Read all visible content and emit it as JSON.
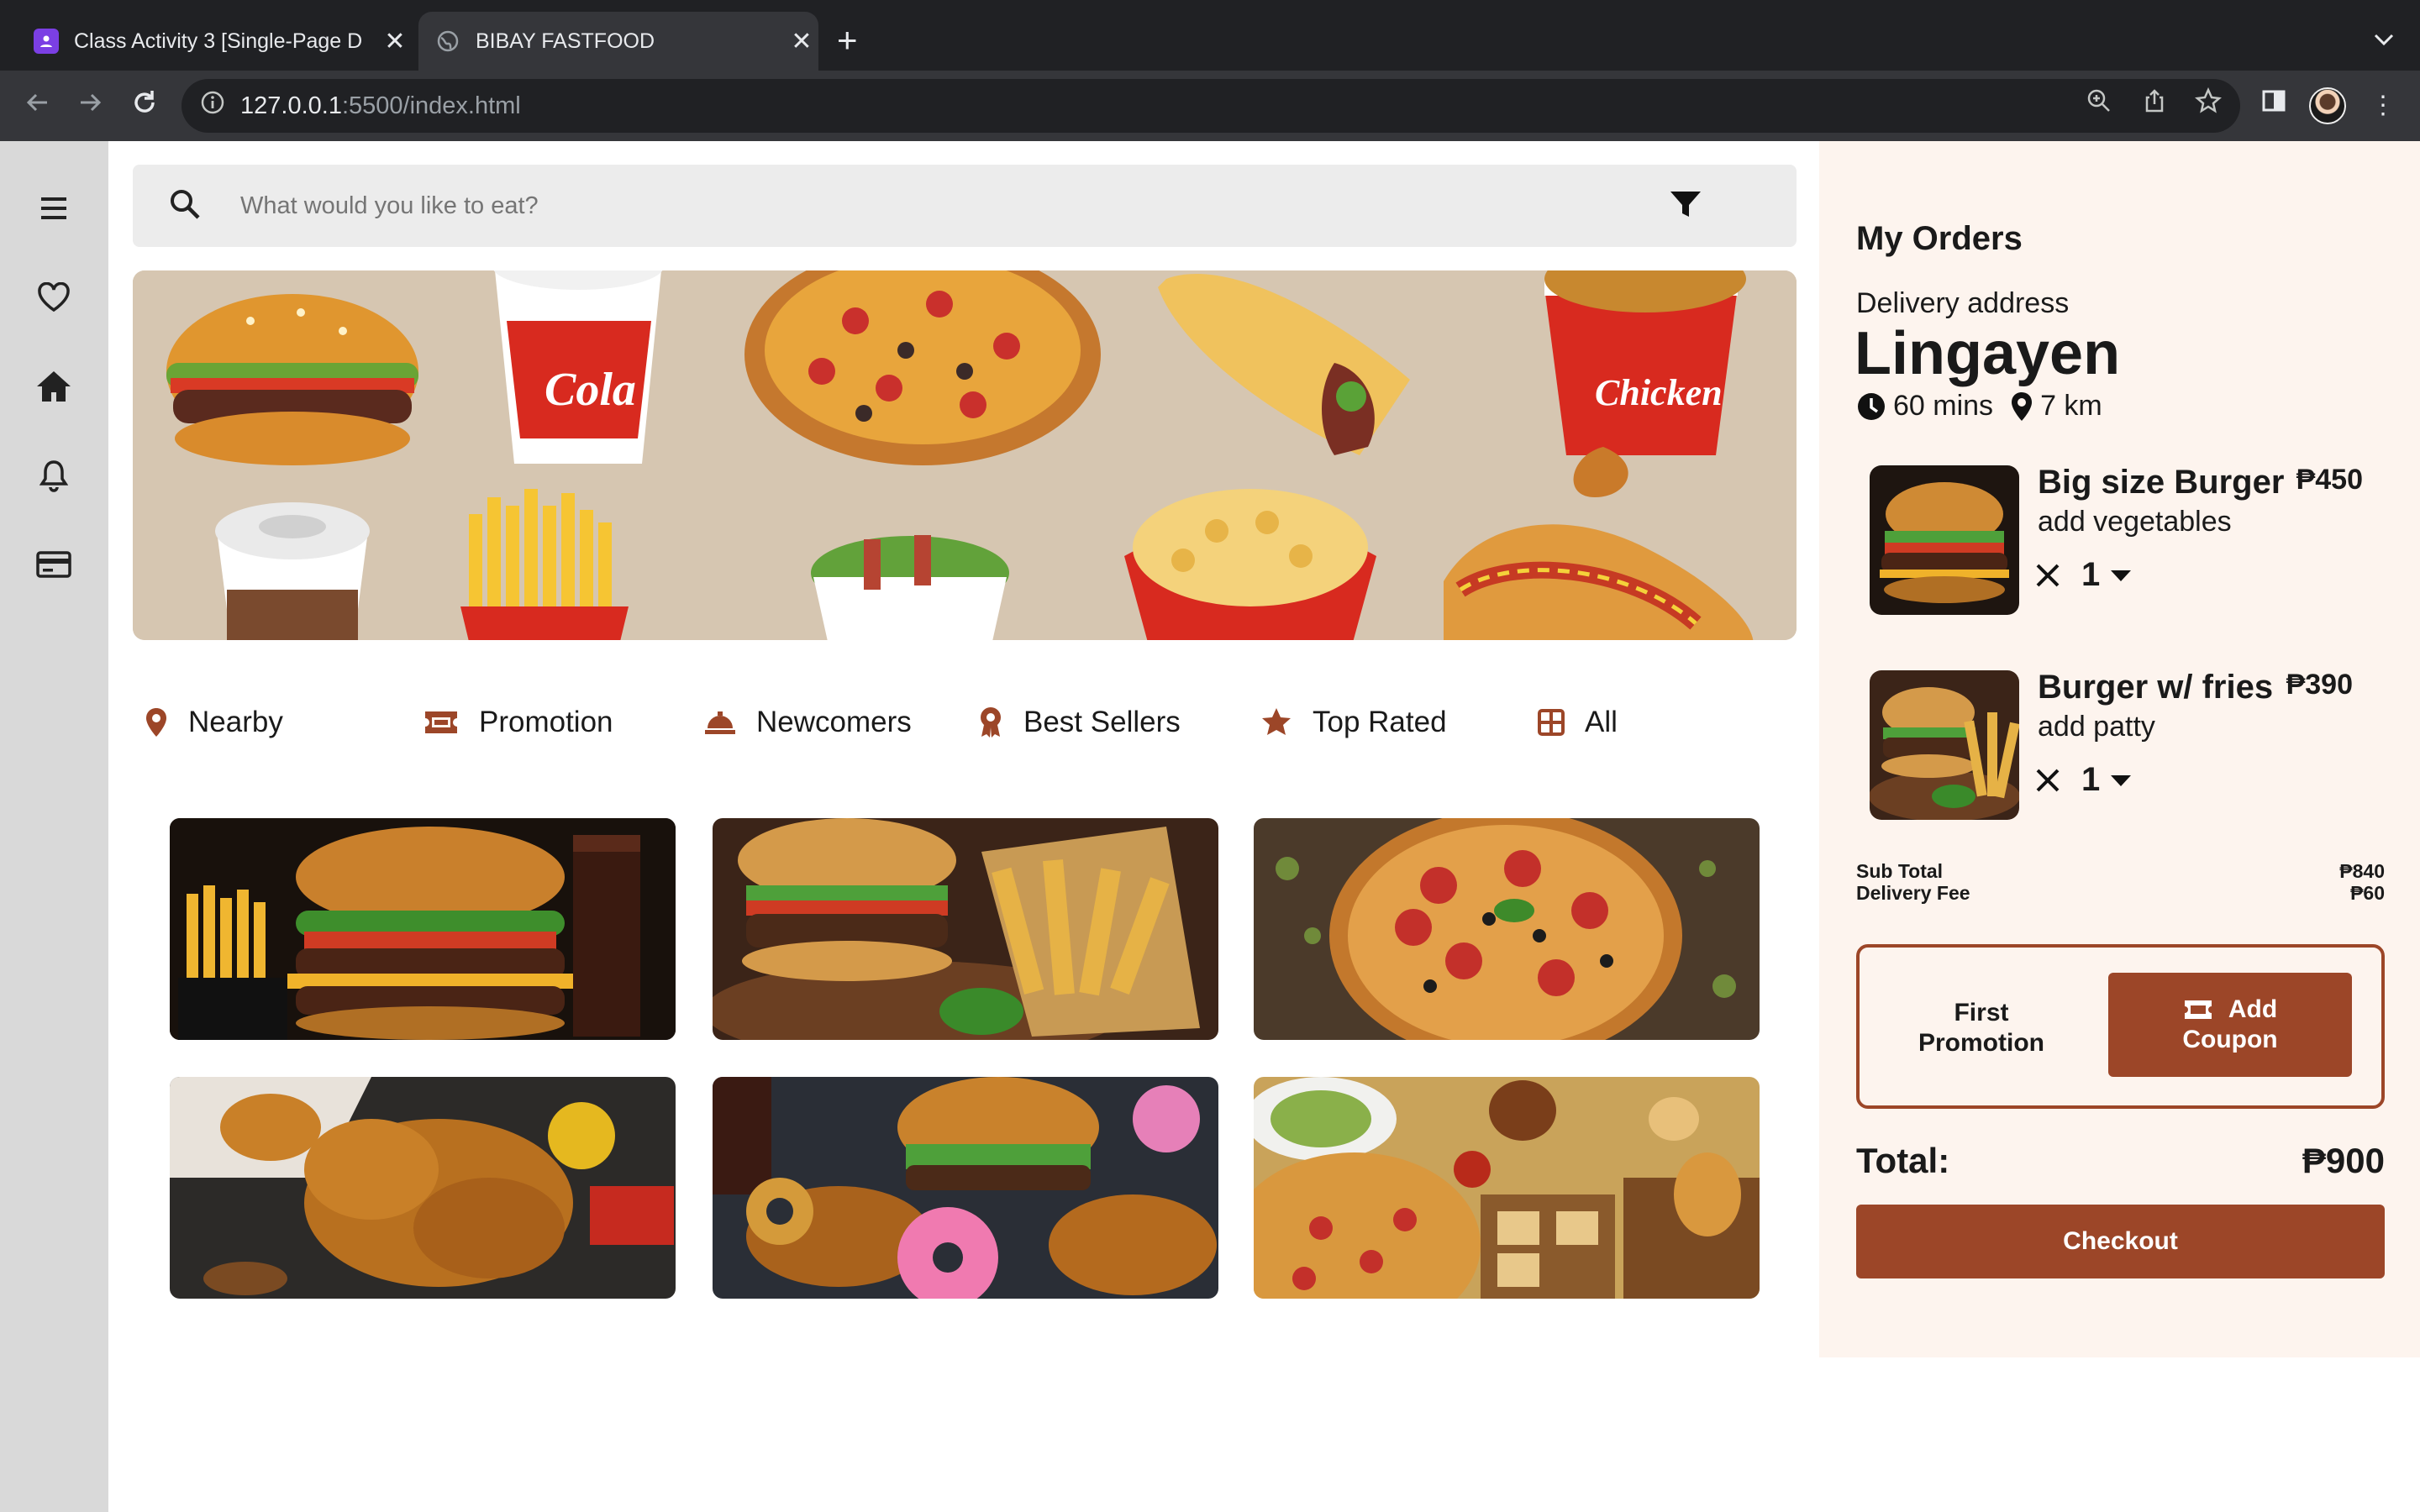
{
  "browser": {
    "tabs": [
      {
        "title": "Class Activity 3 [Single-Page D",
        "active": false
      },
      {
        "title": "BIBAY FASTFOOD",
        "active": true
      }
    ],
    "url_host": "127.0.0.1",
    "url_path": ":5500/index.html"
  },
  "search": {
    "placeholder": "What would you like to eat?"
  },
  "categories": [
    "Nearby",
    "Promotion",
    "Newcomers",
    "Best Sellers",
    "Top Rated",
    "All"
  ],
  "banner_labels": {
    "cup": "Cola",
    "bucket": "Chicken"
  },
  "orders": {
    "title": "My Orders",
    "address_label": "Delivery address",
    "address": "Lingayen",
    "time": "60 mins",
    "distance": "7 km",
    "items": [
      {
        "name": "Big size Burger",
        "price": "₱450",
        "note": "add vegetables",
        "qty": "1"
      },
      {
        "name": "Burger w/ fries",
        "price": "₱390",
        "note": "add patty",
        "qty": "1"
      }
    ],
    "subtotal_label": "Sub Total",
    "subtotal": "₱840",
    "delivery_label": "Delivery Fee",
    "delivery": "₱60",
    "promo_line1": "First",
    "promo_line2": "Promotion",
    "coupon_line1": "Add",
    "coupon_line2": "Coupon",
    "total_label": "Total:",
    "total": "₱900",
    "checkout": "Checkout"
  },
  "colors": {
    "accent": "#9c4628",
    "panel": "#fdf4ee",
    "sidebar": "#d9d9d9"
  }
}
